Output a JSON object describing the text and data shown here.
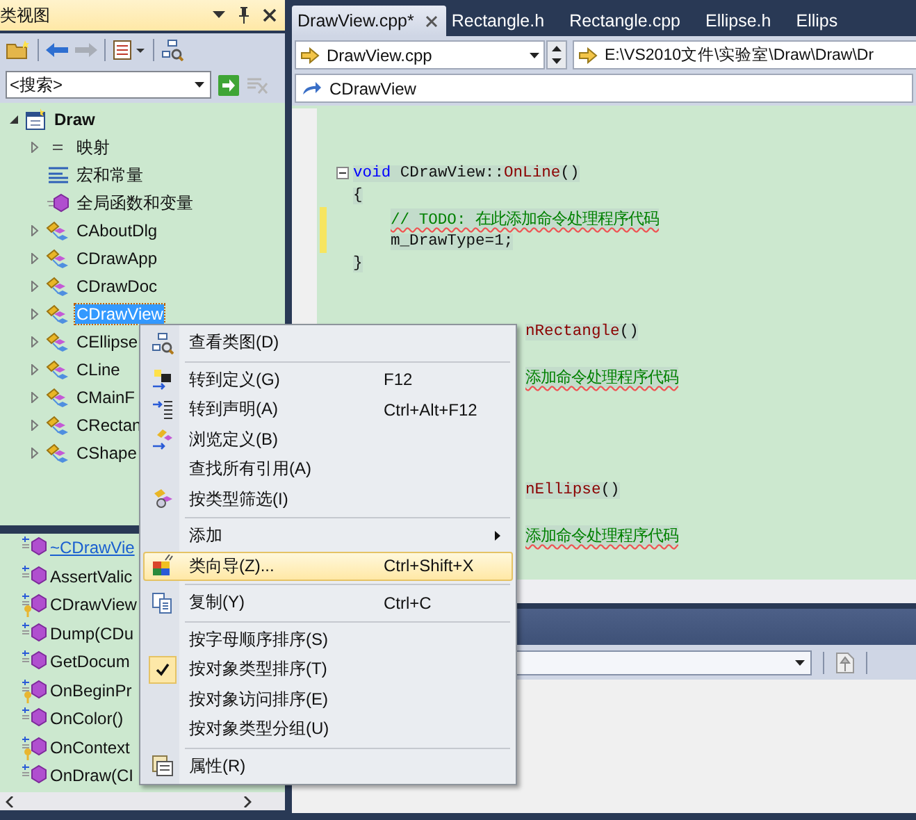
{
  "class_view": {
    "title": "类视图",
    "search": {
      "placeholder": "<搜索>"
    },
    "tree": [
      {
        "label": "Draw",
        "kind": "project",
        "expanded": true,
        "selected": false,
        "children": [
          {
            "label": "映射",
            "kind": "map",
            "expanded": false,
            "selected": false
          },
          {
            "label": "宏和常量",
            "kind": "macro",
            "selected": false
          },
          {
            "label": "全局函数和变量",
            "kind": "global",
            "selected": false
          },
          {
            "label": "CAboutDlg",
            "kind": "class",
            "expanded": false,
            "selected": false
          },
          {
            "label": "CDrawApp",
            "kind": "class",
            "expanded": false,
            "selected": false
          },
          {
            "label": "CDrawDoc",
            "kind": "class",
            "expanded": false,
            "selected": false
          },
          {
            "label": "CDrawView",
            "kind": "class",
            "expanded": false,
            "selected": true
          },
          {
            "label": "CEllipse",
            "kind": "class",
            "expanded": false,
            "selected": false
          },
          {
            "label": "CLine",
            "kind": "class",
            "expanded": false,
            "selected": false
          },
          {
            "label": "CMainF",
            "kind": "class",
            "expanded": false,
            "selected": false
          },
          {
            "label": "CRectan",
            "kind": "class",
            "expanded": false,
            "selected": false
          },
          {
            "label": "CShape",
            "kind": "class",
            "expanded": false,
            "selected": false
          }
        ]
      }
    ],
    "members": [
      {
        "label": "~CDrawVie",
        "kind": "public",
        "hovered": true
      },
      {
        "label": "AssertValic",
        "kind": "public",
        "hovered": false
      },
      {
        "label": "CDrawView",
        "kind": "protected",
        "hovered": false
      },
      {
        "label": "Dump(CDu",
        "kind": "public",
        "hovered": false
      },
      {
        "label": "GetDocum",
        "kind": "public",
        "hovered": false
      },
      {
        "label": "OnBeginPr",
        "kind": "protected",
        "hovered": false
      },
      {
        "label": "OnColor()",
        "kind": "public",
        "hovered": false
      },
      {
        "label": "OnContext",
        "kind": "protected",
        "hovered": false
      },
      {
        "label": "OnDraw(CI",
        "kind": "public",
        "hovered": false
      }
    ]
  },
  "editor": {
    "tabs": [
      {
        "label": "DrawView.cpp*",
        "selected": true
      },
      {
        "label": "Rectangle.h",
        "selected": false
      },
      {
        "label": "Rectangle.cpp",
        "selected": false
      },
      {
        "label": "Ellipse.h",
        "selected": false
      },
      {
        "label": "Ellips",
        "selected": false
      }
    ],
    "file_combo": "DrawView.cpp",
    "path": "E:\\VS2010文件\\实验室\\Draw\\Draw\\Dr",
    "scope": "CDrawView",
    "lines": [
      {
        "kind": "spacer"
      },
      {
        "kind": "spacer"
      },
      {
        "kind": "code",
        "fold": true,
        "changed": false,
        "indented": false,
        "segments": [
          {
            "kind": "keyword",
            "text": "void"
          },
          {
            "kind": "plain",
            "text": " CDrawView::"
          },
          {
            "kind": "function",
            "text": "OnLine"
          },
          {
            "kind": "plain",
            "text": "()"
          }
        ]
      },
      {
        "kind": "code",
        "fold": false,
        "changed": false,
        "indented": false,
        "segments": [
          {
            "kind": "plain",
            "text": "{"
          }
        ]
      },
      {
        "kind": "code",
        "fold": false,
        "changed": true,
        "indented": true,
        "segments": [
          {
            "kind": "comment",
            "text": "// TODO: 在此添加命令处理程序代码"
          }
        ]
      },
      {
        "kind": "code",
        "fold": false,
        "changed": true,
        "indented": true,
        "segments": [
          {
            "kind": "plain",
            "text": "m_DrawType=1;"
          }
        ]
      },
      {
        "kind": "code",
        "fold": false,
        "changed": false,
        "indented": false,
        "segments": [
          {
            "kind": "plain",
            "text": "}"
          }
        ]
      },
      {
        "kind": "spacer"
      },
      {
        "kind": "spacer"
      },
      {
        "kind": "fragment",
        "segments": [
          {
            "kind": "function",
            "text": "nRectangle"
          },
          {
            "kind": "plain",
            "text": "()"
          }
        ]
      },
      {
        "kind": "spacer"
      },
      {
        "kind": "fragment",
        "segments": [
          {
            "kind": "comment",
            "text": "添加命令处理程序代码"
          }
        ]
      },
      {
        "kind": "spacer"
      },
      {
        "kind": "spacer"
      },
      {
        "kind": "spacer"
      },
      {
        "kind": "spacer"
      },
      {
        "kind": "fragment",
        "segments": [
          {
            "kind": "function",
            "text": "nEllipse"
          },
          {
            "kind": "plain",
            "text": "()"
          }
        ]
      },
      {
        "kind": "spacer"
      },
      {
        "kind": "fragment",
        "segments": [
          {
            "kind": "comment",
            "text": "添加命令处理程序代码"
          }
        ]
      }
    ]
  },
  "context_menu": {
    "items": [
      {
        "kind": "item",
        "label": "查看类图(D)",
        "selected": false,
        "checked": false
      },
      {
        "kind": "separator"
      },
      {
        "kind": "item",
        "label": "转到定义(G)",
        "shortcut": "F12",
        "selected": false,
        "checked": false
      },
      {
        "kind": "item",
        "label": "转到声明(A)",
        "shortcut": "Ctrl+Alt+F12",
        "selected": false,
        "checked": false
      },
      {
        "kind": "item",
        "label": "浏览定义(B)",
        "selected": false,
        "checked": false
      },
      {
        "kind": "item",
        "label": "查找所有引用(A)",
        "selected": false,
        "checked": false
      },
      {
        "kind": "item",
        "label": "按类型筛选(I)",
        "selected": false,
        "checked": false
      },
      {
        "kind": "separator"
      },
      {
        "kind": "item",
        "label": "添加",
        "submenu": true,
        "selected": false,
        "checked": false
      },
      {
        "kind": "item",
        "label": "类向导(Z)...",
        "shortcut": "Ctrl+Shift+X",
        "selected": true,
        "checked": false
      },
      {
        "kind": "separator"
      },
      {
        "kind": "item",
        "label": "复制(Y)",
        "shortcut": "Ctrl+C",
        "selected": false,
        "checked": false
      },
      {
        "kind": "separator"
      },
      {
        "kind": "item",
        "label": "按字母顺序排序(S)",
        "selected": false,
        "checked": false
      },
      {
        "kind": "item",
        "label": "按对象类型排序(T)",
        "selected": false,
        "checked": true
      },
      {
        "kind": "item",
        "label": "按对象访问排序(E)",
        "selected": false,
        "checked": false
      },
      {
        "kind": "item",
        "label": "按对象类型分组(U)",
        "selected": false,
        "checked": false
      },
      {
        "kind": "separator"
      },
      {
        "kind": "item",
        "label": "属性(R)",
        "selected": false,
        "checked": false
      }
    ]
  }
}
